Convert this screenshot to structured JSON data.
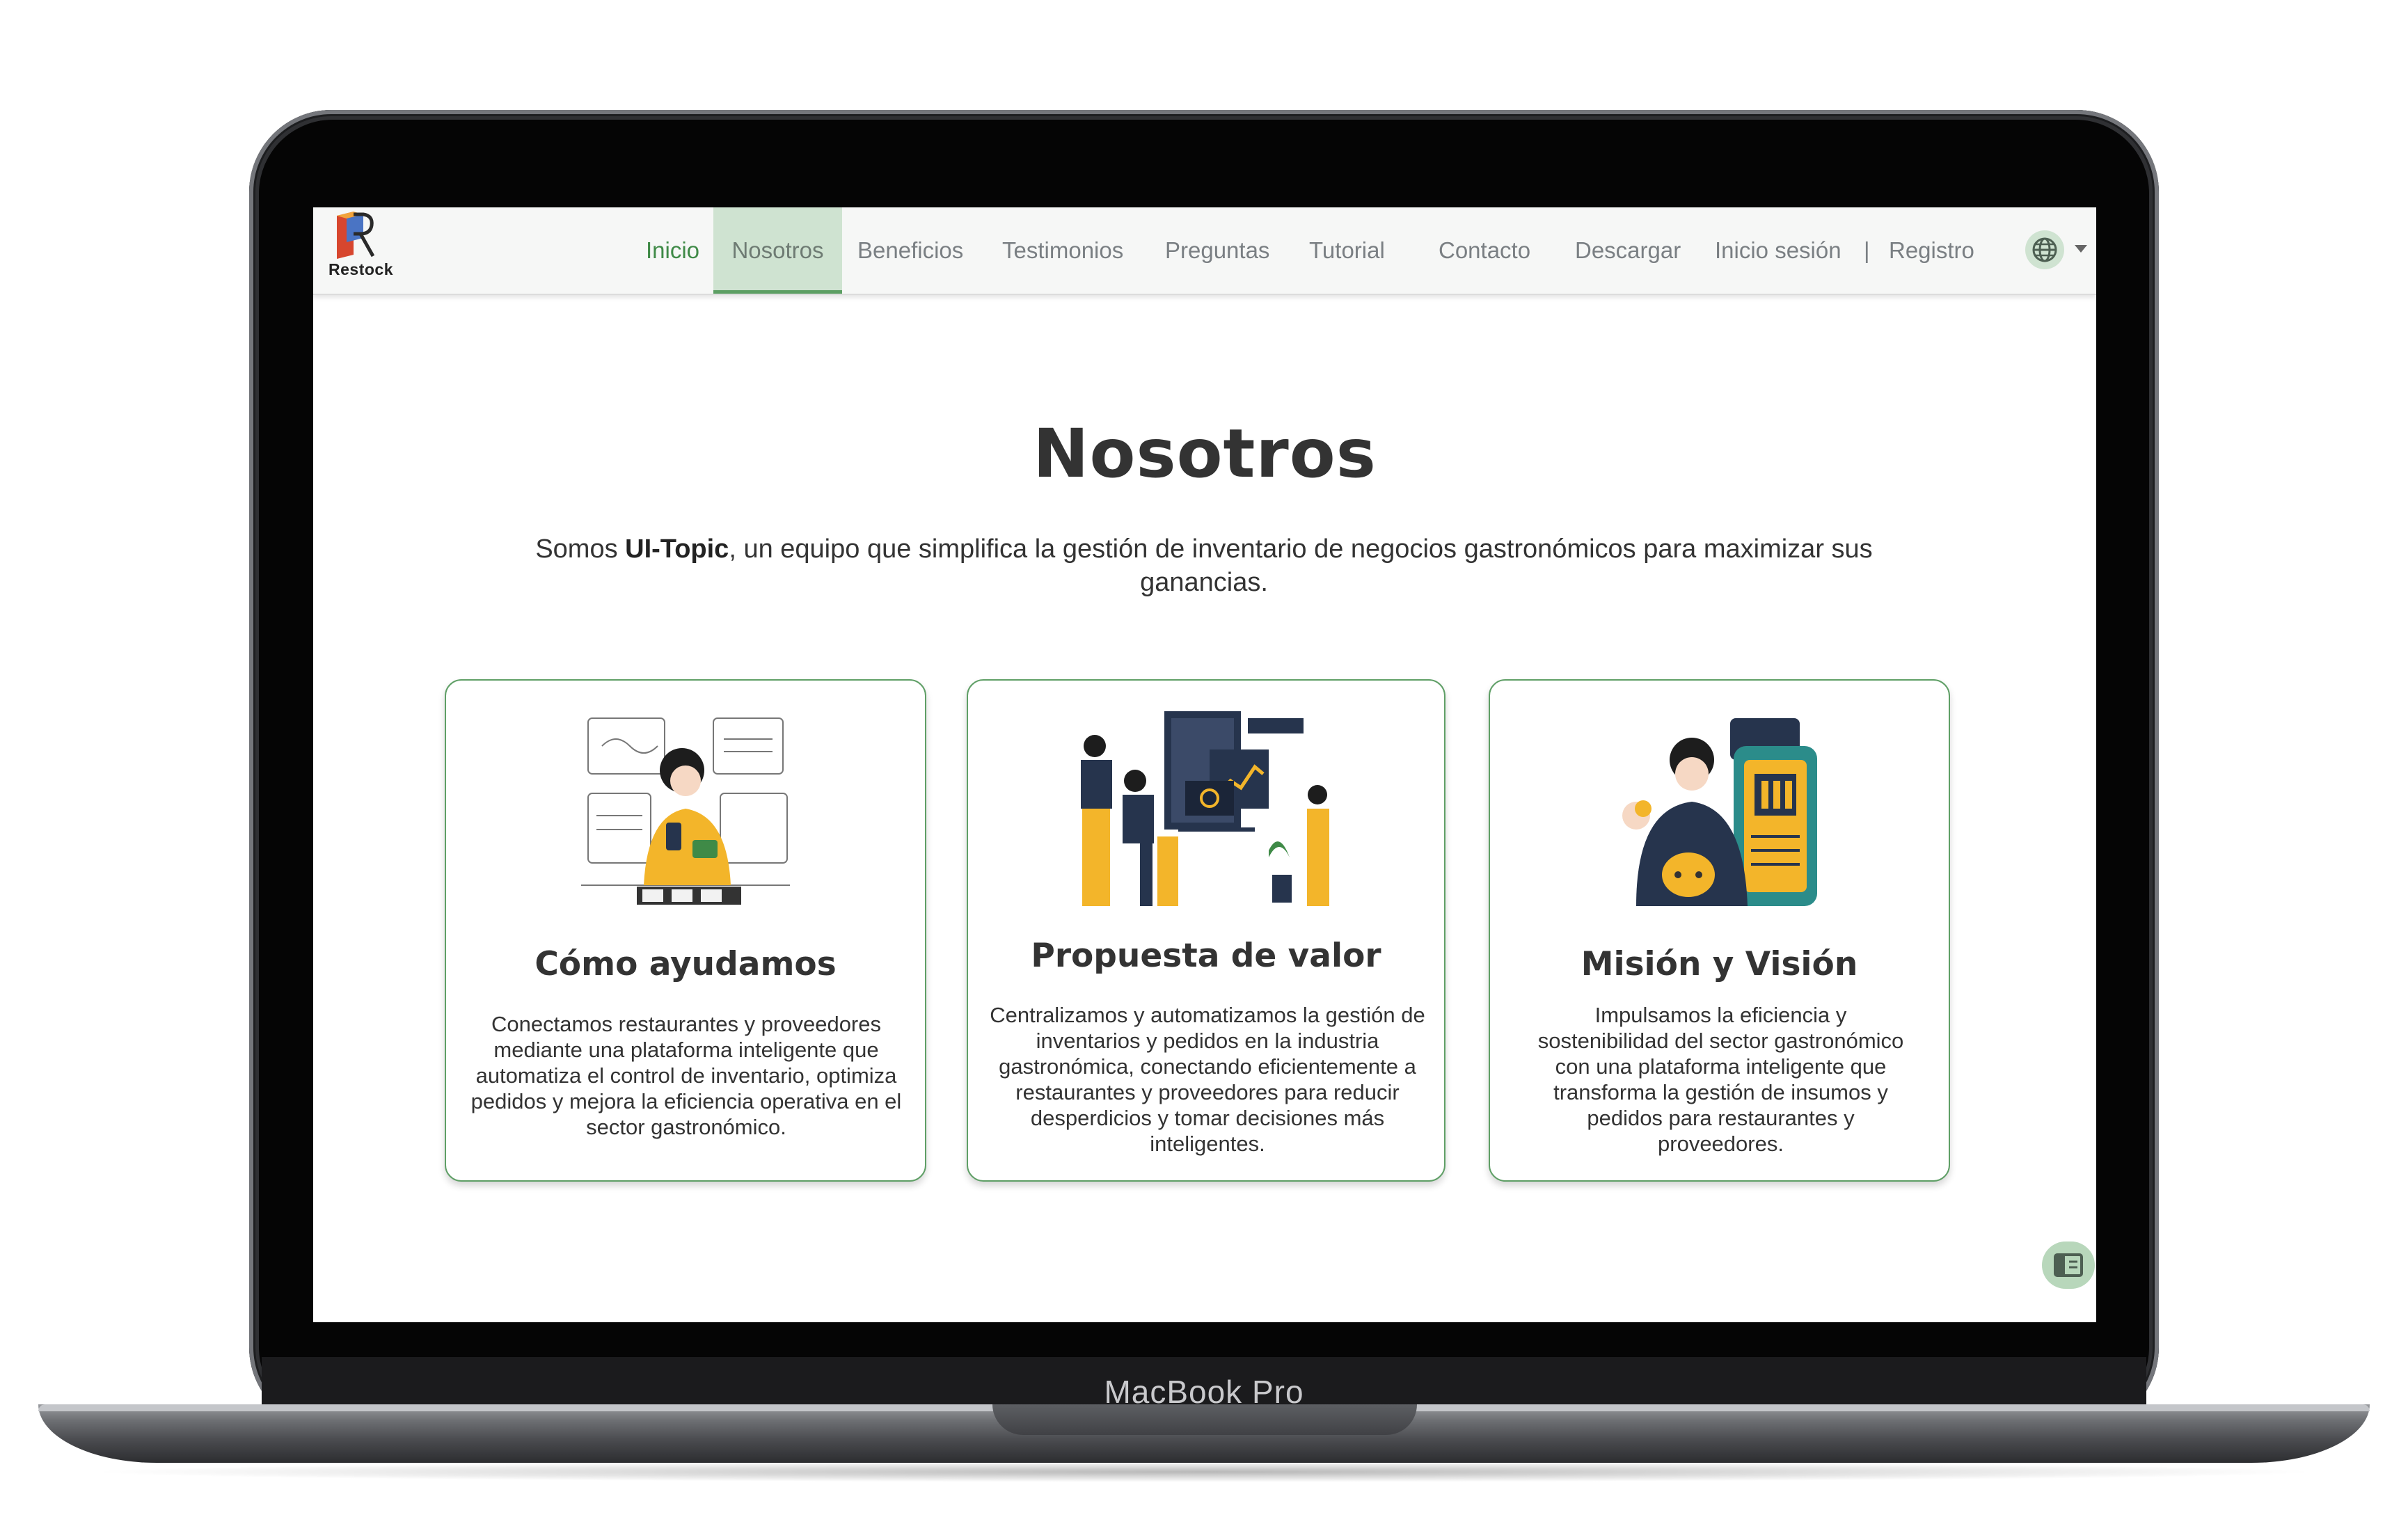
{
  "device": {
    "label": "MacBook Pro"
  },
  "brand": {
    "name": "Restock"
  },
  "nav": {
    "items": [
      {
        "label": "Inicio"
      },
      {
        "label": "Nosotros"
      },
      {
        "label": "Beneficios"
      },
      {
        "label": "Testimonios"
      },
      {
        "label": "Preguntas"
      },
      {
        "label": "Tutorial"
      },
      {
        "label": "Contacto"
      },
      {
        "label": "Descargar"
      }
    ],
    "active": "Nosotros",
    "login": "Inicio sesión",
    "separator": "|",
    "register": "Registro",
    "language_icon": "globe-icon"
  },
  "main": {
    "title": "Nosotros",
    "intro_prefix": "Somos ",
    "intro_bold": "UI-Topic",
    "intro_rest": ", un equipo que simplifica la gestión de inventario de negocios gastronómicos para maximizar sus ganancias.",
    "cards": [
      {
        "title": "Cómo ayudamos",
        "text": "Conectamos restaurantes y proveedores mediante una plataforma inteligente que automatiza el control de inventario, optimiza pedidos y mejora la eficiencia operativa en el sector gastronómico."
      },
      {
        "title": "Propuesta de valor",
        "text": "Centralizamos y automatizamos la gestión de inventarios y pedidos en la industria gastronómica, conectando eficientemente a restaurantes y proveedores para reducir desperdicios y tomar decisiones más inteligentes."
      },
      {
        "title": "Misión y Visión",
        "text": "Impulsamos la eficiencia y sostenibilidad del sector gastronómico con una plataforma inteligente que transforma la gestión de insumos y pedidos para restaurantes y proveedores."
      }
    ]
  },
  "colors": {
    "accent": "#3f8a47",
    "active_bg": "#cfe3d1",
    "card_border": "#5f9f66",
    "illustration_yellow": "#f3b52a",
    "illustration_navy": "#26344d"
  }
}
